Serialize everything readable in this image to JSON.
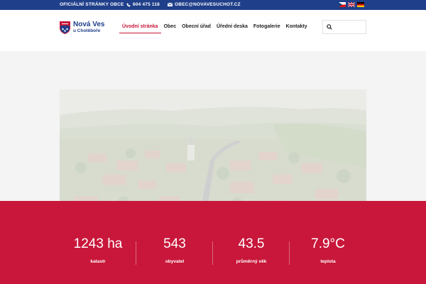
{
  "topbar": {
    "official": "OFICIÁLNÍ STRÁNKY OBCE",
    "phone": "604 475 118",
    "email": "OBEC@NOVAVESUCHOT.CZ",
    "phone_icon": "phone-icon",
    "email_icon": "envelope-icon",
    "languages": [
      "cs",
      "en",
      "de"
    ]
  },
  "logo": {
    "line1": "Nová Ves",
    "line2": "u Chotěboře"
  },
  "nav": {
    "items": [
      "Úvodní stránka",
      "Obec",
      "Obecní úřad",
      "Úřední deska",
      "Fotogalerie",
      "Kontakty"
    ],
    "active": "Úvodní stránka"
  },
  "search": {
    "placeholder": "",
    "icon": "search-icon"
  },
  "stats": [
    {
      "value": "1243 ha",
      "label": "katastr"
    },
    {
      "value": "543",
      "label": "obyvatel"
    },
    {
      "value": "43.5",
      "label": "průměrný věk"
    },
    {
      "value": "7.9°C",
      "label": "teplota"
    }
  ],
  "colors": {
    "brand_blue": "#1f3f8a",
    "accent_red": "#c8173a"
  }
}
